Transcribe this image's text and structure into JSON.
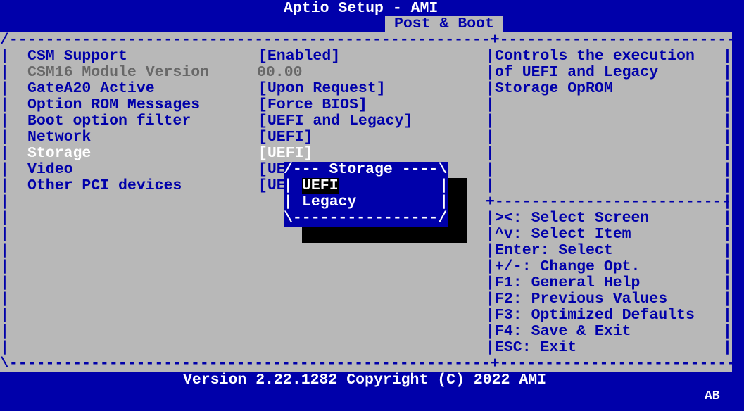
{
  "header": {
    "title": "Aptio Setup - AMI",
    "active_tab": "Post & Boot"
  },
  "frame": {
    "top_left": "/-----------------------------------------------------+-----------------------------\\",
    "bottom": "\\-----------------------------------------------------+-----------------------------/",
    "divider_right": "+-----------------------------"
  },
  "settings": [
    {
      "label": "CSM Support",
      "value": "[Enabled]",
      "state": "normal"
    },
    {
      "label": "CSM16 Module Version",
      "value": "00.00",
      "state": "disabled"
    },
    {
      "label": "GateA20 Active",
      "value": "[Upon Request]",
      "state": "normal"
    },
    {
      "label": "Option ROM Messages",
      "value": "[Force BIOS]",
      "state": "normal"
    },
    {
      "label": "Boot option filter",
      "value": "[UEFI and Legacy]",
      "state": "normal"
    },
    {
      "label": "Network",
      "value": "[UEFI]",
      "state": "normal"
    },
    {
      "label": "Storage",
      "value": "[UEFI]",
      "state": "selected"
    },
    {
      "label": "Video",
      "value": "[UE",
      "state": "normal"
    },
    {
      "label": "Other PCI devices",
      "value": "[UE",
      "state": "normal"
    }
  ],
  "help": {
    "lines": [
      "Controls the execution",
      "of UEFI and Legacy",
      "Storage OpROM"
    ]
  },
  "keys": [
    "><: Select Screen",
    "^v: Select Item",
    "Enter: Select",
    "+/-: Change Opt.",
    "F1: General Help",
    "F2: Previous Values",
    "F3: Optimized Defaults",
    "F4: Save & Exit",
    "ESC: Exit"
  ],
  "popup": {
    "top": "/--- Storage ----\\",
    "bottom": "\\----------------/",
    "options": [
      "UEFI",
      "Legacy"
    ],
    "selected_index": 0
  },
  "footer": {
    "version": "Version 2.22.1282 Copyright (C) 2022 AMI",
    "badge": "AB"
  }
}
